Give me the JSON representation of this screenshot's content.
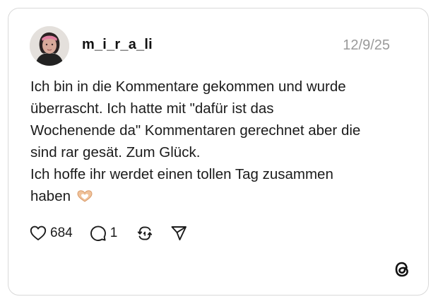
{
  "post": {
    "username": "m_i_r_a_li",
    "date": "12/9/25",
    "text_lines": [
      "Ich bin in die Kommentare gekommen und wurde",
      "überrascht. Ich hatte mit \"dafür ist das",
      "Wochenende da\" Kommentaren gerechnet aber die",
      "sind rar gesät. Zum Glück.",
      "Ich hoffe ihr werdet einen tollen Tag zusammen",
      "haben"
    ],
    "emoji": "heart-hands-emoji",
    "likes": "684",
    "replies": "1"
  },
  "icons": {
    "like": "heart-icon",
    "reply": "comment-icon",
    "repost": "repost-icon",
    "share": "send-icon",
    "brand": "threads-logo"
  },
  "colors": {
    "text": "#1b1b1b",
    "muted": "#9a9a9a",
    "border": "#d9d9d9"
  }
}
